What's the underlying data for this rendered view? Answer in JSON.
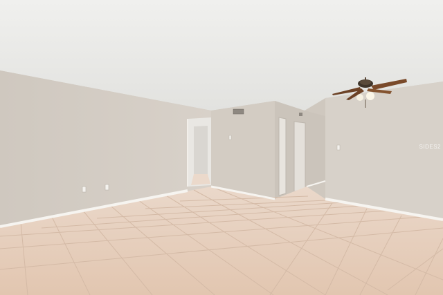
{
  "image": {
    "scene": "empty-room-interior",
    "watermark_text": "SIDES2",
    "colors": {
      "ceiling": "#e9e9e6",
      "wall": "#d6d0c8",
      "wall_shadow": "#c9c2b9",
      "floor_tile": "#e6cdb9",
      "grout": "#d2b7a2",
      "baseboard": "#f4f2ee",
      "door": "#e7e3dd",
      "fan_blade": "#7a4a2a"
    },
    "icons": [
      "ceiling-fan-icon",
      "light-switch-icon",
      "outlet-icon",
      "ceiling-vent-icon",
      "wall-vent-icon"
    ]
  }
}
